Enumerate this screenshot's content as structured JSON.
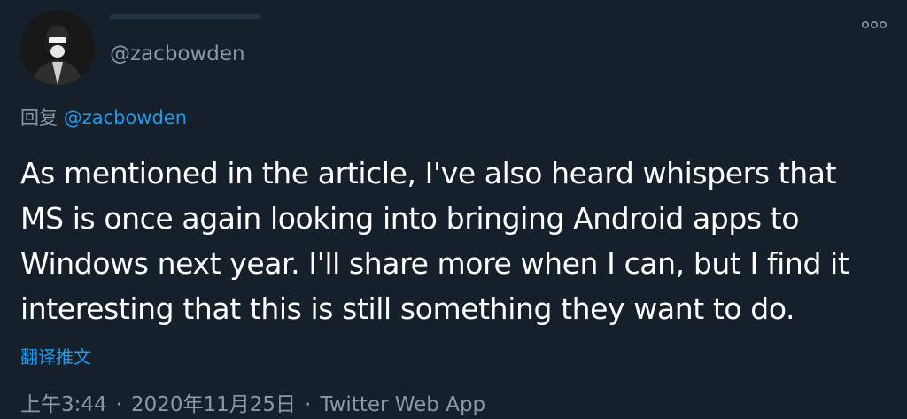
{
  "author": {
    "handle": "@zacbowden",
    "avatar_icon": "person-avatar"
  },
  "header": {
    "more_icon": "more-options-icon"
  },
  "reply": {
    "prefix": "回复",
    "mention": "@zacbowden"
  },
  "tweet": {
    "lines": [
      "As mentioned in the article, I've also heard whispers that",
      "MS is once again looking into bringing Android apps to",
      "Windows next year. I'll share more when I can, but I find it",
      "interesting that this is still something they want to do."
    ]
  },
  "translate_label": "翻译推文",
  "meta": {
    "time": "上午3:44",
    "separator": "·",
    "date": "2020年11月25日",
    "source": "Twitter Web App"
  },
  "colors": {
    "background": "#15202b",
    "text": "#ffffff",
    "secondary": "#8b98a5",
    "accent": "#1d9bf0"
  }
}
